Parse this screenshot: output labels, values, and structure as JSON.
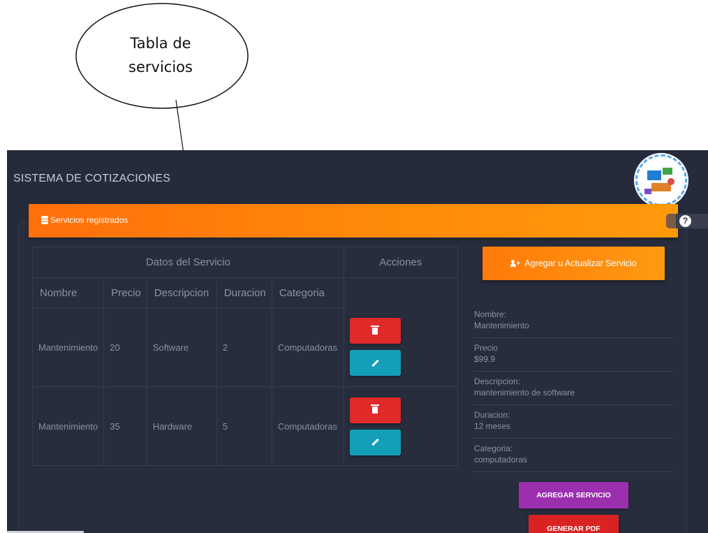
{
  "annotation": {
    "callout_line1": "Tabla de",
    "callout_line2": "servicios"
  },
  "app": {
    "title": "SISTEMA DE COTIZACIONES",
    "logo_icon": "company-logo"
  },
  "banner": {
    "title": "Servicios registrados",
    "icon": "database-icon",
    "help_icon": "?"
  },
  "table": {
    "group_headers": [
      "Datos del Servicio",
      "Acciones"
    ],
    "columns": [
      "Nombre",
      "Precio",
      "Descripcion",
      "Duracion",
      "Categoria"
    ],
    "rows": [
      [
        "Mantenimiento",
        "20",
        "Software",
        "2",
        "Computadoras"
      ],
      [
        "Mantenimiento",
        "35",
        "Hardware",
        "5",
        "Computadoras"
      ]
    ],
    "delete_icon": "trash-icon",
    "edit_icon": "pencil-icon"
  },
  "form": {
    "add_update_label": "Agregar u Actualizar Servicio",
    "fields": [
      {
        "label": "Nombre:",
        "value": "Mantenimiento"
      },
      {
        "label": "Precio",
        "value": "$99.9"
      },
      {
        "label": "Descripcion:",
        "value": "mantenimiento de software"
      },
      {
        "label": "Duracion:",
        "value": "12 meses"
      },
      {
        "label": "Categoria:",
        "value": "computadoras"
      }
    ],
    "add_service_label": "AGREGAR SERVICIO",
    "generate_pdf_label": "GENERAR PDF"
  },
  "colors": {
    "background": "#252b3b",
    "accent_orange": "#ff8a0a",
    "delete_red": "#e02a2a",
    "edit_teal": "#149fb8",
    "add_purple": "#9b2fae",
    "pdf_red": "#d92323"
  }
}
